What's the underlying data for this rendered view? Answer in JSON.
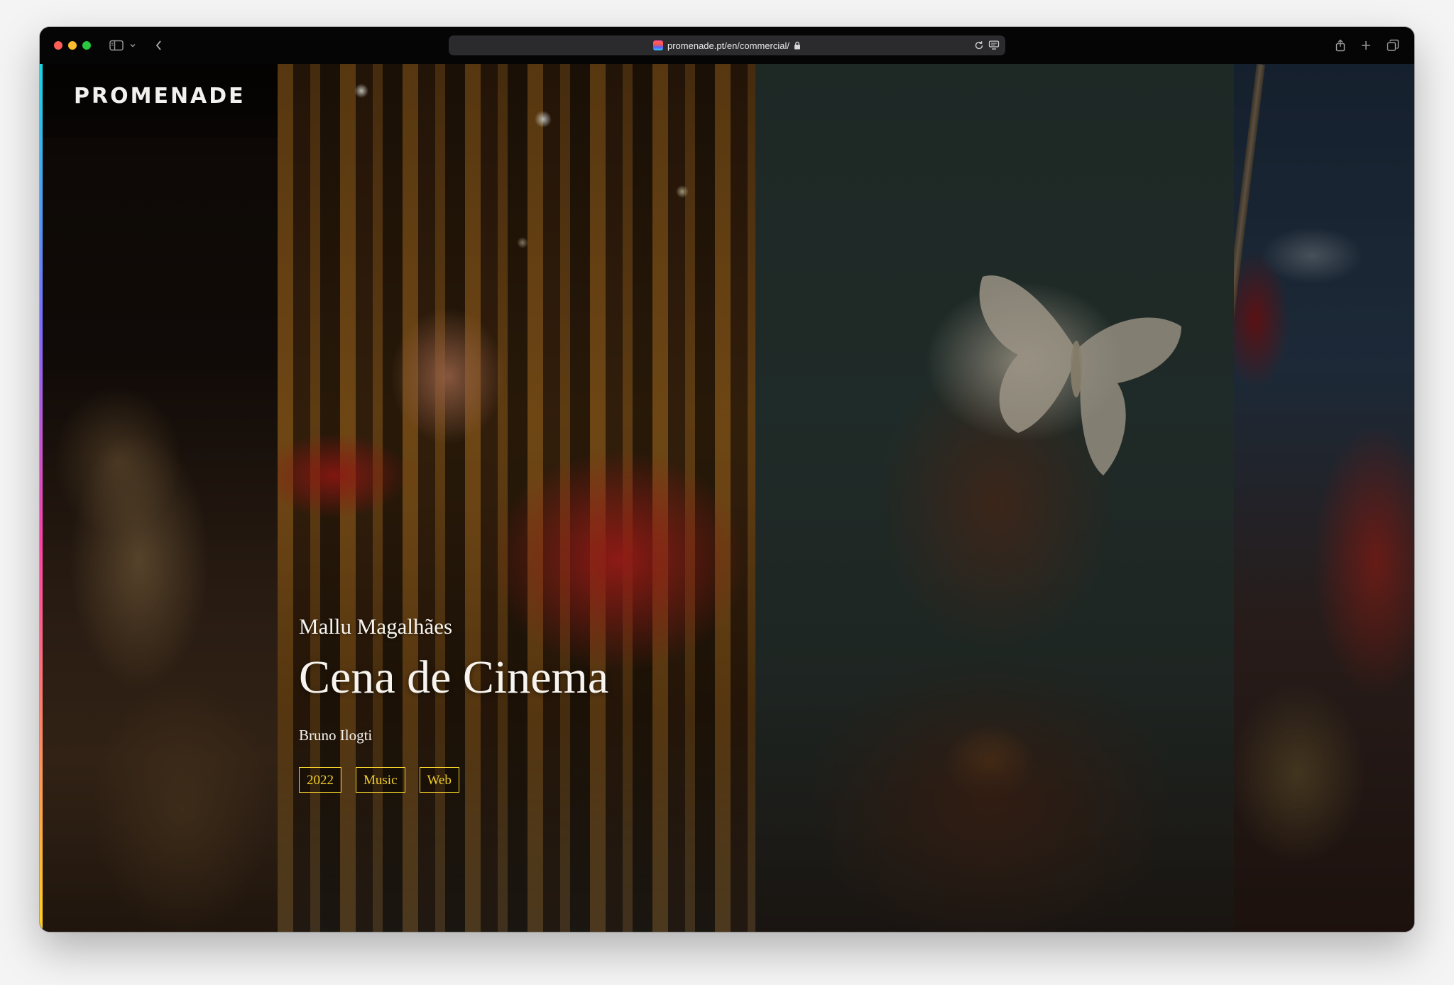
{
  "browser": {
    "url": "promenade.pt/en/commercial/"
  },
  "site": {
    "logo": "PROMENADE"
  },
  "project": {
    "artist": "Mallu Magalhães",
    "title": "Cena de Cinema",
    "director": "Bruno Ilogti",
    "tags": [
      "2022",
      "Music",
      "Web"
    ]
  },
  "colors": {
    "tag_accent": "#f2cf2a",
    "window_chrome": "#050505",
    "address_bar": "#2b2b2d"
  }
}
